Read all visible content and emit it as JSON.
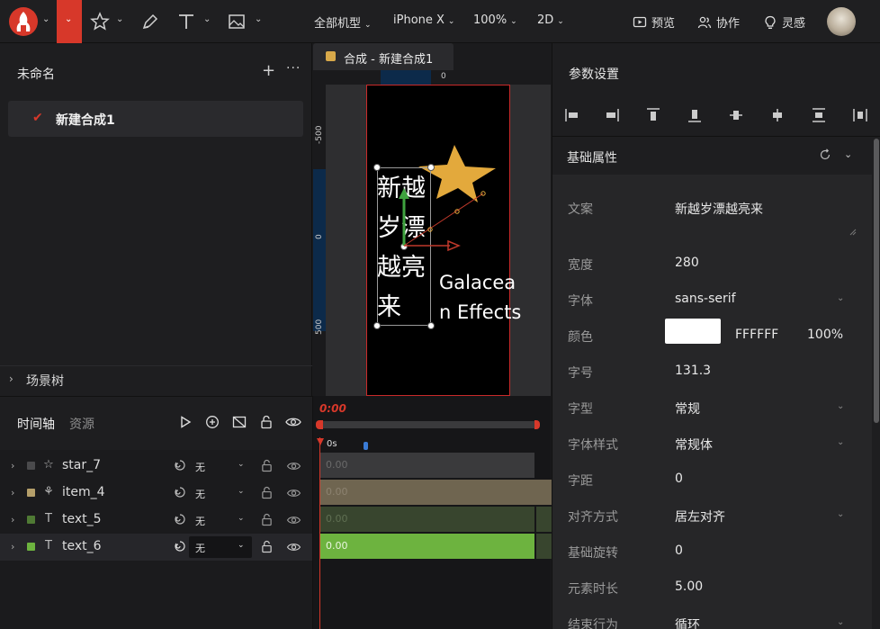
{
  "toolbar": {
    "device_select": "全部机型",
    "model_select": "iPhone X",
    "zoom_select": "100%",
    "mode_select": "2D",
    "preview_label": "预览",
    "collab_label": "协作",
    "inspiration_label": "灵感"
  },
  "left_panel": {
    "project_title": "未命名",
    "plus": "+",
    "more": "···",
    "composition_item": "新建合成1",
    "scene_tree_label": "场景树"
  },
  "canvas": {
    "tab_label": "合成 - 新建合成1",
    "ruler_top_zero": "0",
    "ruler_left": [
      "-500",
      "0",
      "500"
    ],
    "vertical_text_lines": [
      "新越",
      "岁漂",
      "越亮",
      "来"
    ],
    "galacean_lines": [
      "Galacea",
      "n Effects"
    ]
  },
  "timeline": {
    "tab_timeline": "时间轴",
    "tab_assets": "资源",
    "current_time": "0:00",
    "ruler_start": "0s",
    "layers": [
      {
        "name": "star_7",
        "color": "#4a4a4c",
        "icon": "☆",
        "ease": "无",
        "clip_value": "0.00"
      },
      {
        "name": "item_4",
        "color": "#b59f6a",
        "icon": "⚘",
        "ease": "无",
        "clip_value": "0.00"
      },
      {
        "name": "text_5",
        "color": "#4f7a34",
        "icon": "T",
        "ease": "无",
        "clip_value": "0.00"
      },
      {
        "name": "text_6",
        "color": "#6db33f",
        "icon": "T",
        "ease": "无",
        "clip_value": "0.00"
      }
    ]
  },
  "right_panel": {
    "title": "参数设置",
    "section_title": "基础属性",
    "props": {
      "text_label": "文案",
      "text_value": "新越岁漂越亮来",
      "width_label": "宽度",
      "width_value": "280",
      "font_label": "字体",
      "font_value": "sans-serif",
      "color_label": "颜色",
      "color_hex": "FFFFFF",
      "color_opacity": "100%",
      "size_label": "字号",
      "size_value": "131.3",
      "weight_label": "字型",
      "weight_value": "常规",
      "style_label": "字体样式",
      "style_value": "常规体",
      "spacing_label": "字距",
      "spacing_value": "0",
      "align_label": "对齐方式",
      "align_value": "居左对齐",
      "rotation_label": "基础旋转",
      "rotation_value": "0",
      "duration_label": "元素时长",
      "duration_value": "5.00",
      "end_label": "结束行为",
      "end_value": "循环"
    }
  },
  "colors": {
    "accent": "#d7382a",
    "star": "#e3a93c",
    "selected_clip": "#6db33f"
  }
}
